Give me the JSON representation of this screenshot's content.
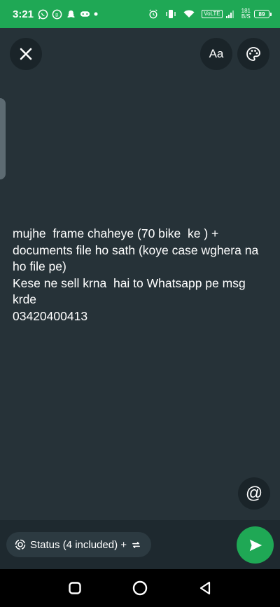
{
  "status_bar": {
    "time": "3:21",
    "network_type": "VoLTE",
    "speed_value": "181",
    "speed_unit": "B/S",
    "battery": "89",
    "left_icons": [
      "whatsapp-icon",
      "whatsapp-business-icon",
      "snapchat-icon",
      "game-controller-icon",
      "dot-icon"
    ],
    "right_icons": [
      "alarm-icon",
      "vibrate-icon",
      "wifi-icon",
      "signal-icon",
      "battery-icon"
    ]
  },
  "toolbar": {
    "font_label": "Aa"
  },
  "status": {
    "text": "mujhe  frame chaheye (70 bike  ke ) +\ndocuments file ho sath (koye case wghera na\nho file pe)\nKese ne sell krna  hai to Whatsapp pe msg\nkrde\n03420400413",
    "background_color": "#263238"
  },
  "mention": {
    "label": "@"
  },
  "audience": {
    "label": "Status (4 included) +"
  },
  "colors": {
    "accent": "#1fa855",
    "background": "#263238"
  }
}
